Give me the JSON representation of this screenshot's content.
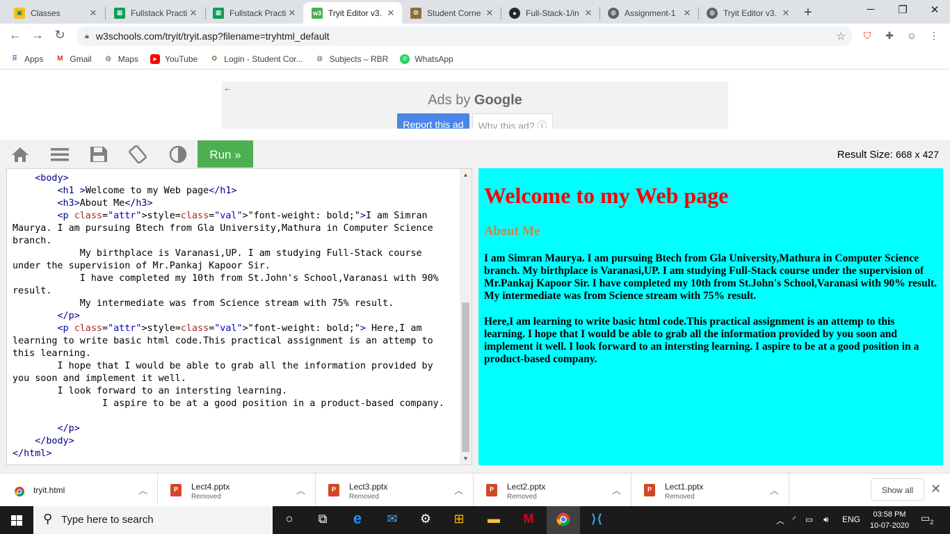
{
  "tabs": [
    {
      "title": "Classes",
      "icon": "classroom-icon",
      "active": false
    },
    {
      "title": "Fullstack Practi",
      "icon": "sheets-icon",
      "active": false
    },
    {
      "title": "Fullstack Practi",
      "icon": "sheets-icon",
      "active": false
    },
    {
      "title": "Tryit Editor v3.",
      "icon": "w3schools-icon",
      "active": true
    },
    {
      "title": "Student Corne",
      "icon": "student-corner-icon",
      "active": false
    },
    {
      "title": "Full-Stack-1/in",
      "icon": "github-icon",
      "active": false
    },
    {
      "title": "Assignment-1",
      "icon": "globe-icon",
      "active": false
    },
    {
      "title": "Tryit Editor v3.",
      "icon": "globe-icon",
      "active": false
    }
  ],
  "address": {
    "url": "w3schools.com/tryit/tryit.asp?filename=tryhtml_default"
  },
  "bookmarks": [
    {
      "label": "Apps"
    },
    {
      "label": "Gmail"
    },
    {
      "label": "Maps"
    },
    {
      "label": "YouTube"
    },
    {
      "label": "Login - Student Cor..."
    },
    {
      "label": "Subjects – RBR"
    },
    {
      "label": "WhatsApp"
    }
  ],
  "ad": {
    "ads_by": "Ads by",
    "brand": "Google",
    "report_label": "Report this ad",
    "why_label": "Why this ad? ⓘ"
  },
  "trybar": {
    "run_label": "Run »",
    "result_size_label": "Result Size:",
    "result_width": "668",
    "result_x": "x",
    "result_height": "427"
  },
  "editor": {
    "lines": [
      "    <body>",
      "        <h1 >Welcome to my Web page</h1>",
      "        <h3>About Me</h3>",
      "        <p style=\"font-weight: bold;\">I am Simran Maurya. I am pursuing Btech from Gla University,Mathura in Computer Science branch.",
      "            My birthplace is Varanasi,UP. I am studying Full-Stack course under the supervision of Mr.Pankaj Kapoor Sir.",
      "            I have completed my 10th from St.John's School,Varanasi with 90% result.",
      "            My intermediate was from Science stream with 75% result.",
      "        </p>",
      "        <p style=\"font-weight: bold;\"> Here,I am learning to write basic html code.This practical assignment is an attemp to this learning.",
      "        I hope that I would be able to grab all the information provided by you soon and implement it well.",
      "        I look forward to an intersting learning.",
      "                I aspire to be at a good position in a product-based company.",
      "",
      "        </p>",
      "    </body>",
      "</html>"
    ]
  },
  "result": {
    "h1": "Welcome to my Web page",
    "h3": "About Me",
    "p1": "I am Simran Maurya. I am pursuing Btech from Gla University,Mathura in Computer Science branch. My birthplace is Varanasi,UP. I am studying Full-Stack course under the supervision of Mr.Pankaj Kapoor Sir. I have completed my 10th from St.John's School,Varanasi with 90% result. My intermediate was from Science stream with 75% result.",
    "p2": "Here,I am learning to write basic html code.This practical assignment is an attemp to this learning. I hope that I would be able to grab all the information provided by you soon and implement it well. I look forward to an intersting learning. I aspire to be at a good position in a product-based company.",
    "h1_color": "#ff0000",
    "h3_color": "#cd853f",
    "background": "#00ffff"
  },
  "downloads": [
    {
      "name": "tryit.html",
      "status": "",
      "type": "chrome"
    },
    {
      "name": "Lect4.pptx",
      "status": "Removed",
      "type": "pptx"
    },
    {
      "name": "Lect3.pptx",
      "status": "Removed",
      "type": "pptx"
    },
    {
      "name": "Lect2.pptx",
      "status": "Removed",
      "type": "pptx"
    },
    {
      "name": "Lect1.pptx",
      "status": "Removed",
      "type": "pptx"
    }
  ],
  "downloads_show_all": "Show all",
  "taskbar": {
    "search_placeholder": "Type here to search",
    "language": "ENG",
    "time": "03:58 PM",
    "date": "10-07-2020",
    "notification_count": "2"
  }
}
